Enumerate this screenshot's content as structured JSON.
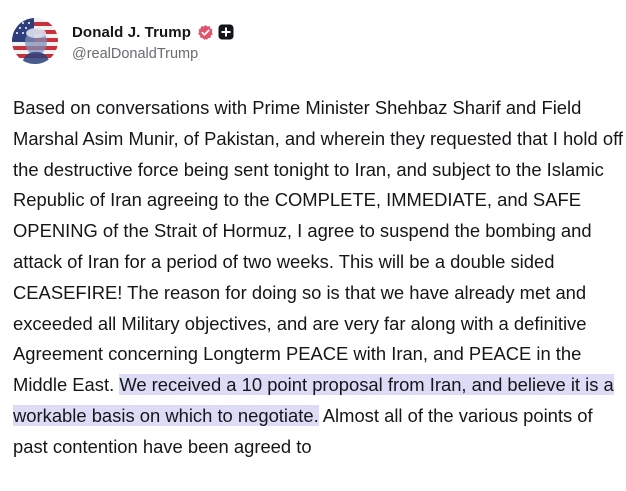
{
  "author": {
    "display_name": "Donald J. Trump",
    "handle": "@realDonaldTrump",
    "avatar_icon": "avatar-flag-portrait",
    "verified_icon": "verified-badge-icon",
    "verified_color": "#e2546e",
    "plus_icon": "plus-icon"
  },
  "post": {
    "text_before_highlight": "Based on conversations with Prime Minister Shehbaz Sharif and Field Marshal Asim Munir, of Pakistan, and wherein they requested that I hold off the destructive force being sent tonight to Iran, and subject to the Islamic Republic of Iran agreeing to the COMPLETE, IMMEDIATE, and SAFE OPENING of the Strait of Hormuz, I agree to suspend the bombing and attack of Iran for a period of two weeks. This will be a double sided CEASEFIRE! The reason for doing so is that we have already met and exceeded all Military objectives, and are very far along with a definitive Agreement concerning Longterm PEACE with Iran, and PEACE in the Middle East. ",
    "highlighted_text": "We received a 10 point proposal from Iran, and believe it is a workable basis on which to negotiate.",
    "text_after_highlight": " Almost all of the various points of past contention have been agreed to",
    "highlight_color": "#dcdcf7"
  }
}
